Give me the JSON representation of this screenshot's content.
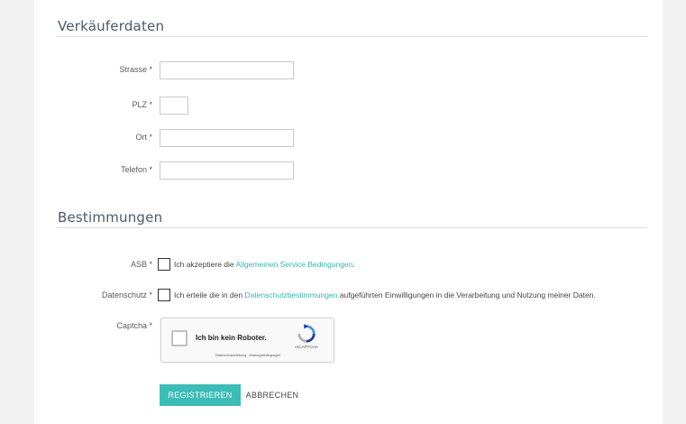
{
  "seller_section": {
    "title": "Verkäuferdaten",
    "fields": {
      "street": {
        "label": "Strasse *",
        "value": ""
      },
      "zip": {
        "label": "PLZ *",
        "value": ""
      },
      "city": {
        "label": "Ort *",
        "value": ""
      },
      "phone": {
        "label": "Telefon *",
        "value": ""
      }
    }
  },
  "terms_section": {
    "title": "Bestimmungen",
    "asb": {
      "label": "ASB *",
      "text_before": "Ich akzeptiere die ",
      "link": "Allgemeinen Service Bedingungen",
      "text_after": "."
    },
    "privacy": {
      "label": "Datenschutz *",
      "text_before": "Ich erteile die in den ",
      "link": "Datenschutzbestimmungen",
      "text_after": " aufgeführten Einwilligungen in die Verarbeitung und Nutzung meiner Daten."
    },
    "captcha": {
      "label": "Captcha *",
      "checkbox_text": "Ich bin kein Roboter.",
      "brand": "reCAPTCHA",
      "terms": "Datenschutzerklärung - Nutzungsbedingungen"
    }
  },
  "actions": {
    "register": "REGISTRIEREN",
    "cancel": "ABBRECHEN"
  },
  "colors": {
    "accent": "#3cbcb6",
    "link": "#35b5b0"
  }
}
